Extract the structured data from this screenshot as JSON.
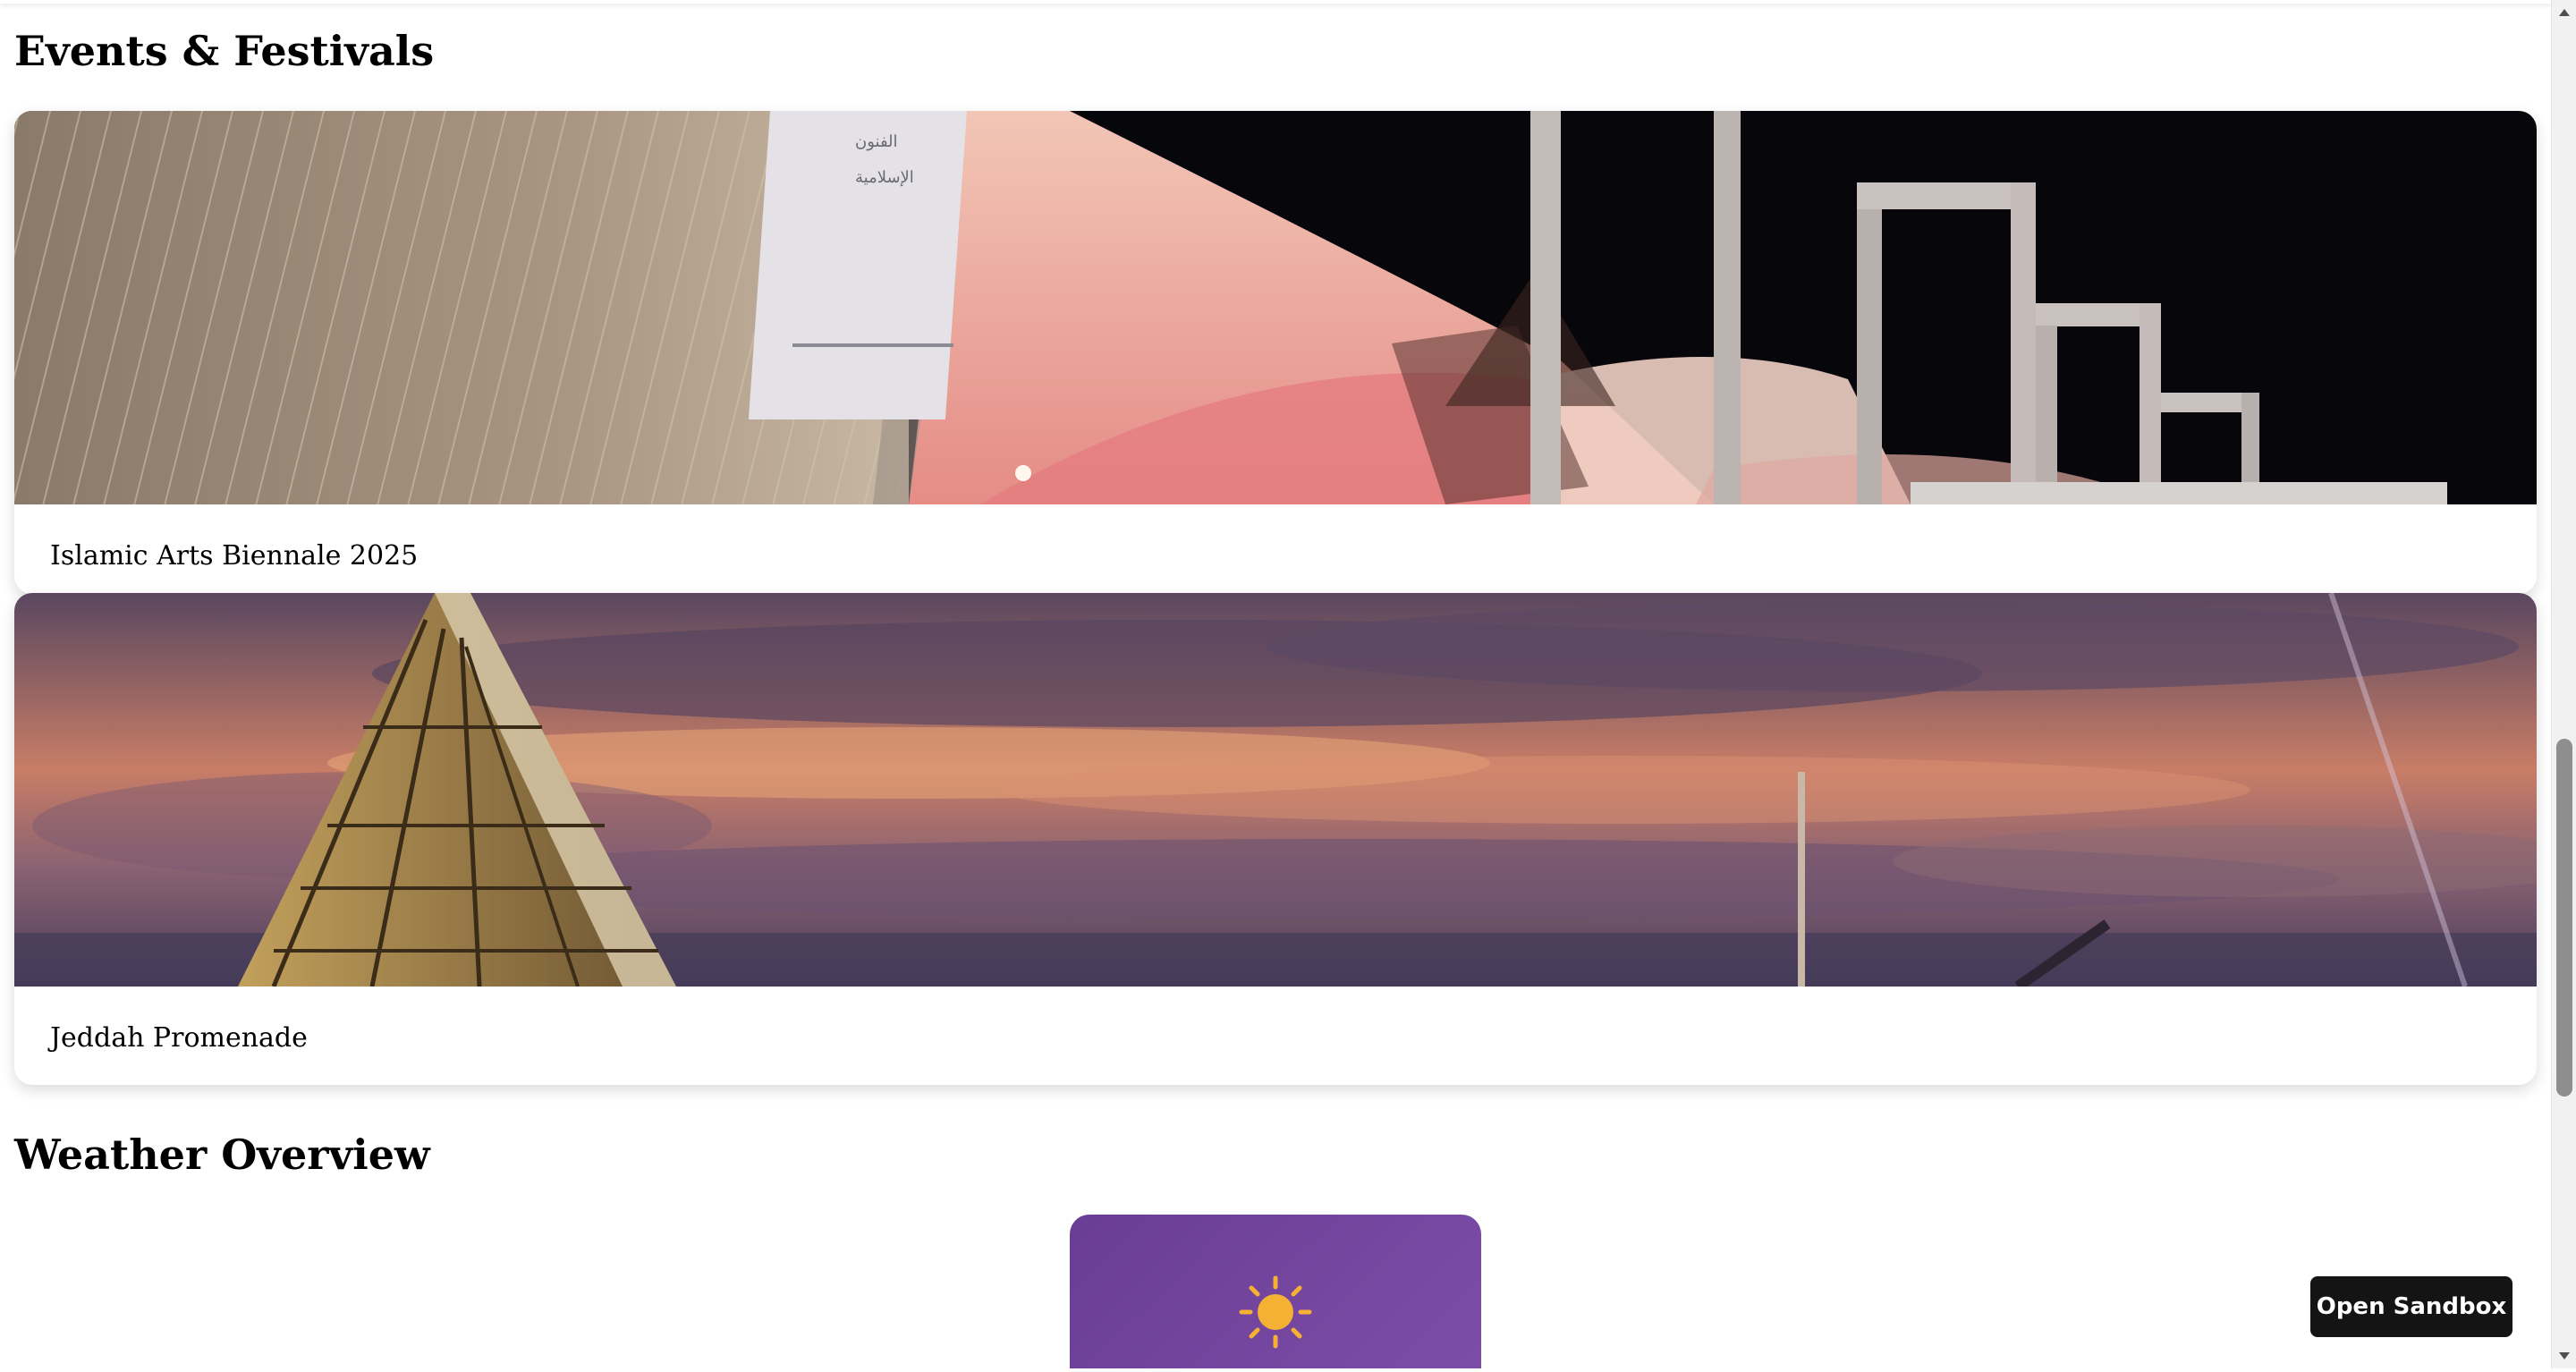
{
  "events_section": {
    "title": "Events & Festivals",
    "items": [
      {
        "caption": "Islamic Arts Biennale 2025",
        "image": "hajj-terminal-tents-night-photo"
      },
      {
        "caption": "Jeddah Promenade",
        "image": "sunset-sky-mosque-photo"
      }
    ]
  },
  "weather_section": {
    "title": "Weather Overview",
    "card": {
      "icon": "sun-icon",
      "color_start": "#6a3d94",
      "color_end": "#7d4ea8"
    }
  },
  "sandbox_button": {
    "label": "Open Sandbox"
  },
  "colors": {
    "sun": "#f5b133",
    "button_bg": "#141414"
  }
}
